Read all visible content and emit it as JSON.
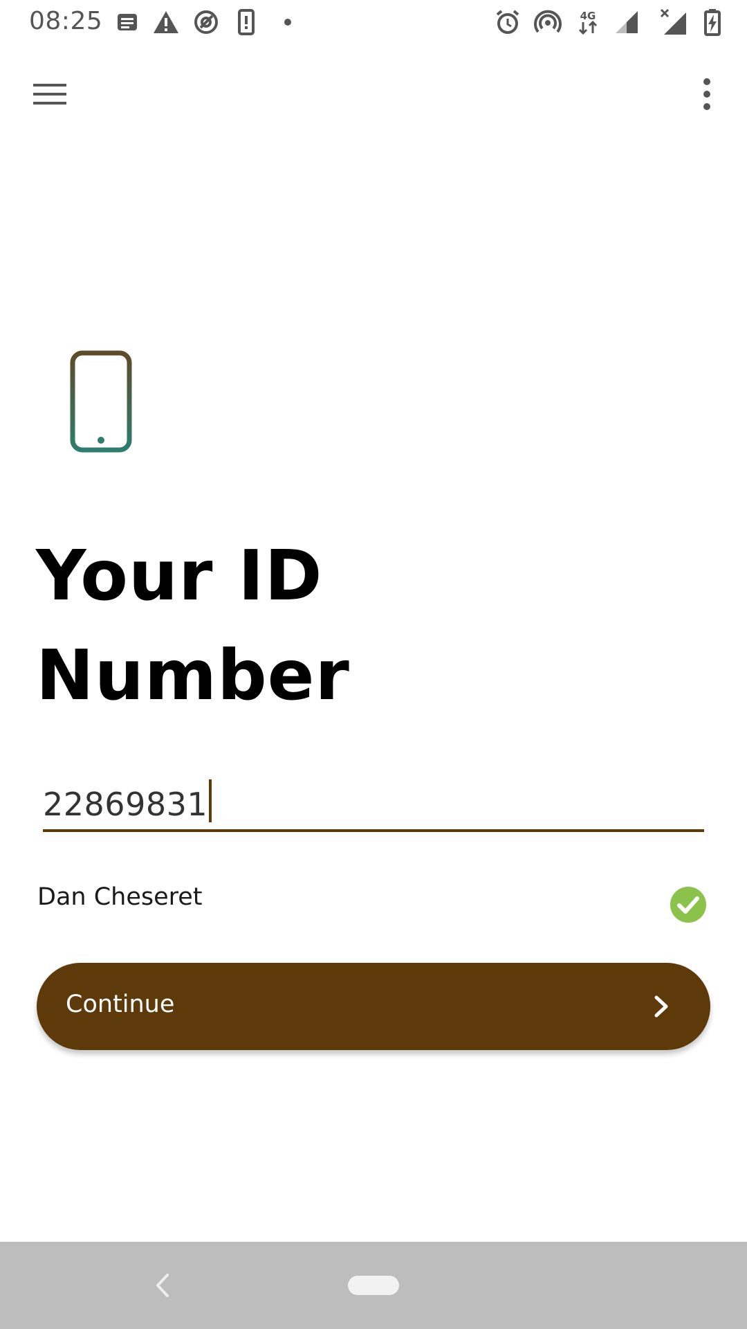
{
  "status_bar": {
    "time": "08:25",
    "left_icons": [
      "notification-card-icon",
      "warning-icon",
      "at-sign-icon",
      "phone-alert-icon",
      "dot-icon"
    ],
    "right_icons": [
      "alarm-icon",
      "hotspot-icon",
      "network-4g-icon",
      "signal-icon",
      "signal-no-data-icon",
      "battery-charging-icon"
    ],
    "network_type": "4G"
  },
  "app_bar": {
    "left_icon": "menu-icon",
    "right_icon": "more-vert-icon"
  },
  "content": {
    "illustration_icon": "smartphone-icon",
    "title_line1": "Your ID",
    "title_line2": "Number",
    "id_field_value": "22869831",
    "owner_name": "Dan Cheseret",
    "verified_icon": "check-circle-icon",
    "continue_label": "Continue",
    "continue_icon": "chevron-right-icon"
  },
  "nav_bar": {
    "back_icon": "back-icon",
    "home_icon": "home-pill-icon"
  },
  "colors": {
    "primary": "#5e3a0b",
    "verified": "#8bc34a",
    "status_icon": "#555555",
    "nav_background": "#bdbdbd"
  }
}
